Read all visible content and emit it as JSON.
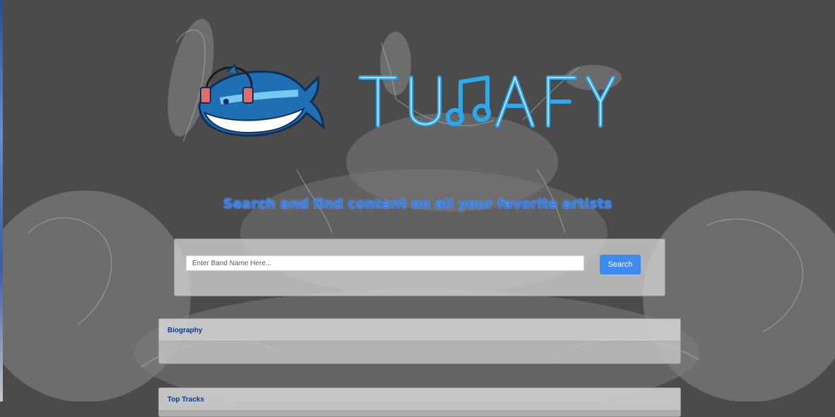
{
  "app": {
    "brand_name": "TUNAFY",
    "tagline": "Search and find content on all your favorite artists"
  },
  "search": {
    "placeholder": "Enter Band Name Here...",
    "value": "",
    "button_label": "Search"
  },
  "sections": {
    "biography_title": "Biography",
    "top_tracks_title": "Top Tracks"
  },
  "colors": {
    "accent": "#3d8bf0",
    "tagline": "#2f7ff0",
    "section_title": "#0b3a8a",
    "brand_stroke": "#2aa8f0"
  },
  "icons": {
    "logo": "tuna-with-headphones-icon",
    "music_note": "music-note-icon"
  }
}
